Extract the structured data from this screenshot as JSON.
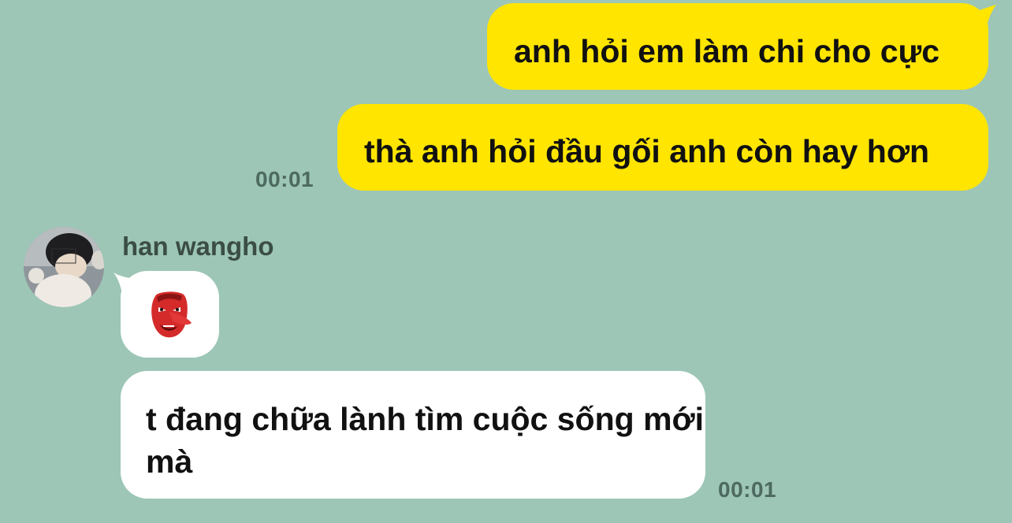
{
  "colors": {
    "background": "#9dc6b6",
    "outgoing_bubble": "#ffe500",
    "incoming_bubble": "#ffffff",
    "timestamp": "#4d6a60"
  },
  "messages": {
    "out_1": "anh hỏi em làm chi cho cực",
    "out_2": "thà anh hỏi đầu gối anh còn hay hơn",
    "out_time": "00:01",
    "sender_name": "han wangho",
    "sticker_icon": "red-tengu-mask-icon",
    "in_1": "t đang chữa lành tìm cuộc sống mới mà",
    "in_time": "00:01"
  }
}
